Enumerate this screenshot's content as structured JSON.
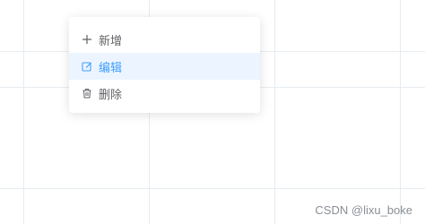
{
  "context_menu": {
    "items": [
      {
        "label": "新增",
        "icon": "plus-icon",
        "active": false
      },
      {
        "label": "编辑",
        "icon": "edit-icon",
        "active": true
      },
      {
        "label": "删除",
        "icon": "trash-icon",
        "active": false
      }
    ]
  },
  "watermark": "CSDN @lixu_boke",
  "colors": {
    "accent": "#409eff",
    "active_bg": "#ecf5ff",
    "text": "#606266",
    "grid": "#e6ecf1"
  }
}
